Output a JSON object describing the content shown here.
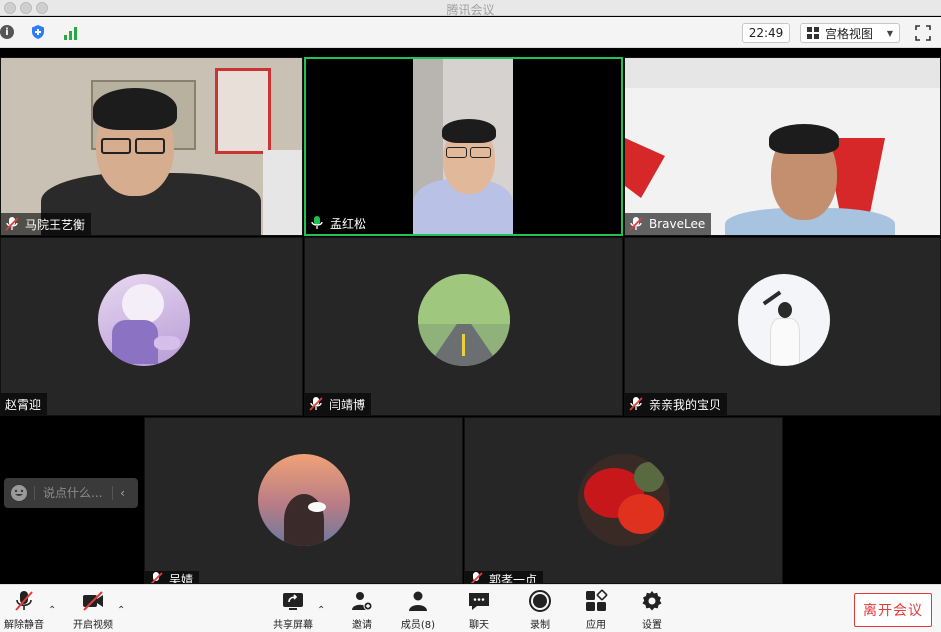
{
  "window": {
    "title": "腾讯会议"
  },
  "toolbar": {
    "time": "22:49",
    "view_label": "宫格视图"
  },
  "participants": [
    {
      "name": "马院王艺衡"
    },
    {
      "name": "孟红松"
    },
    {
      "name": "BraveLee"
    },
    {
      "name": "赵霄迎"
    },
    {
      "name": "闫靖博"
    },
    {
      "name": "亲亲我的宝贝"
    },
    {
      "name": "吴婧"
    },
    {
      "name": "郭孝一贞"
    }
  ],
  "chat": {
    "placeholder": "说点什么..."
  },
  "bottom": {
    "unmute": "解除静音",
    "start_video": "开启视频",
    "share_screen": "共享屏幕",
    "invite": "邀请",
    "members": "成员(8)",
    "chat": "聊天",
    "record": "录制",
    "apps": "应用",
    "settings": "设置",
    "leave": "离开会议"
  },
  "colors": {
    "active_speaker": "#1fc254",
    "leave": "#e03c3c",
    "signal": "#2aa845",
    "shield": "#2d7cf6"
  }
}
